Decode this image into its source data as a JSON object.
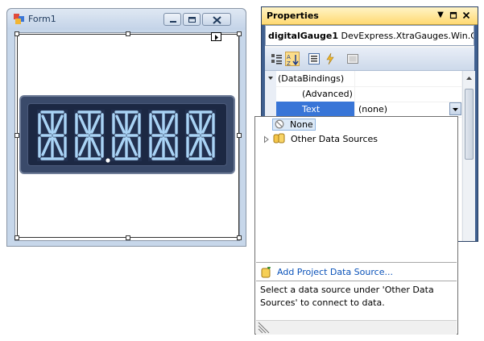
{
  "form": {
    "title": "Form1",
    "gauge_digits": [
      "88",
      "88",
      "88",
      "88",
      "88"
    ]
  },
  "properties": {
    "title": "Properties",
    "selected_object_name": "digitalGauge1",
    "selected_object_type": "DevExpress.XtraGauges.Win.G",
    "rows": [
      {
        "name": "(DataBindings)",
        "value": ""
      },
      {
        "name": "(Advanced)",
        "value": ""
      },
      {
        "name": "Text",
        "value": "(none)"
      }
    ]
  },
  "dropdown": {
    "none_label": "None",
    "other_sources_label": "Other Data Sources",
    "add_source_label": "Add Project Data Source...",
    "description": [
      "Select a data source under 'Other Data",
      "Sources' to connect to data."
    ]
  },
  "colors": {
    "accent": "#3875d7",
    "gauge_bg": "#1c2843",
    "digit": "#a9d3f5",
    "props_title": "#ffd972"
  }
}
